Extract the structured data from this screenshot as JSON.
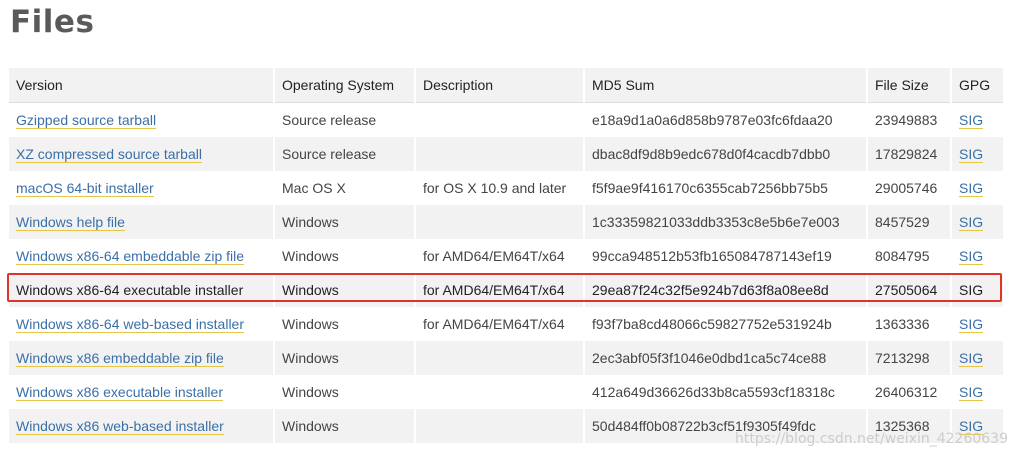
{
  "page": {
    "title": "Files"
  },
  "table": {
    "headers": [
      "Version",
      "Operating System",
      "Description",
      "MD5 Sum",
      "File Size",
      "GPG"
    ],
    "rows": [
      {
        "version": "Gzipped source tarball",
        "os": "Source release",
        "description": "",
        "md5": "e18a9d1a0a6d858b9787e03fc6fdaa20",
        "size": "23949883",
        "gpg": "SIG"
      },
      {
        "version": "XZ compressed source tarball",
        "os": "Source release",
        "description": "",
        "md5": "dbac8df9d8b9edc678d0f4cacdb7dbb0",
        "size": "17829824",
        "gpg": "SIG"
      },
      {
        "version": "macOS 64-bit installer",
        "os": "Mac OS X",
        "description": "for OS X 10.9 and later",
        "md5": "f5f9ae9f416170c6355cab7256bb75b5",
        "size": "29005746",
        "gpg": "SIG"
      },
      {
        "version": "Windows help file",
        "os": "Windows",
        "description": "",
        "md5": "1c33359821033ddb3353c8e5b6e7e003",
        "size": "8457529",
        "gpg": "SIG"
      },
      {
        "version": "Windows x86-64 embeddable zip file",
        "os": "Windows",
        "description": "for AMD64/EM64T/x64",
        "md5": "99cca948512b53fb165084787143ef19",
        "size": "8084795",
        "gpg": "SIG"
      },
      {
        "version": "Windows x86-64 executable installer",
        "os": "Windows",
        "description": "for AMD64/EM64T/x64",
        "md5": "29ea87f24c32f5e924b7d63f8a08ee8d",
        "size": "27505064",
        "gpg": "SIG"
      },
      {
        "version": "Windows x86-64 web-based installer",
        "os": "Windows",
        "description": "for AMD64/EM64T/x64",
        "md5": "f93f7ba8cd48066c59827752e531924b",
        "size": "1363336",
        "gpg": "SIG"
      },
      {
        "version": "Windows x86 embeddable zip file",
        "os": "Windows",
        "description": "",
        "md5": "2ec3abf05f3f1046e0dbd1ca5c74ce88",
        "size": "7213298",
        "gpg": "SIG"
      },
      {
        "version": "Windows x86 executable installer",
        "os": "Windows",
        "description": "",
        "md5": "412a649d36626d33b8ca5593cf18318c",
        "size": "26406312",
        "gpg": "SIG"
      },
      {
        "version": "Windows x86 web-based installer",
        "os": "Windows",
        "description": "",
        "md5": "50d484ff0b08722b3cf51f9305f49fdc",
        "size": "1325368",
        "gpg": "SIG"
      }
    ],
    "highlighted_row": 5
  },
  "watermark": "https://blog.csdn.net/weixin_42260639",
  "colors": {
    "link": "#3a6fa8",
    "link_underline": "#e6c547",
    "highlight_border": "#e0342a",
    "row_stripe": "#f2f2f2"
  }
}
